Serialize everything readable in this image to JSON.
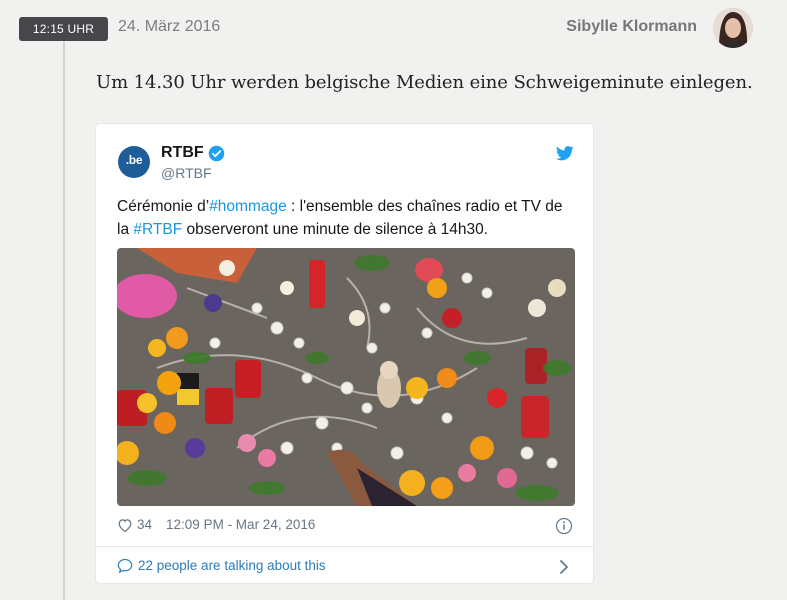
{
  "entry": {
    "time": "12:15 UHR",
    "date": "24. März 2016",
    "author": "Sibylle Klormann",
    "text": "Um 14.30 Uhr werden belgische Medien eine Schweigeminute einlegen."
  },
  "tweet": {
    "avatar_text": ".be",
    "name": "RTBF",
    "handle": "@RTBF",
    "text_parts": {
      "p1": "Cérémonie d’",
      "hashtag1": "#hommage",
      "p2": " : l'ensemble des chaînes radio et TV de la ",
      "hashtag2": "#RTBF",
      "p3": " observeront une minute de silence à 14h30."
    },
    "likes": "34",
    "timestamp": "12:09 PM - Mar 24, 2016",
    "talking": "22 people are talking about this"
  },
  "colors": {
    "link": "#1b95e0",
    "badge_bg": "#45474a",
    "twitter_blue": "#1da1f2"
  },
  "icons": [
    "verified-icon",
    "twitter-bird-icon",
    "heart-icon",
    "info-icon",
    "speech-bubble-icon",
    "chevron-right-icon"
  ]
}
